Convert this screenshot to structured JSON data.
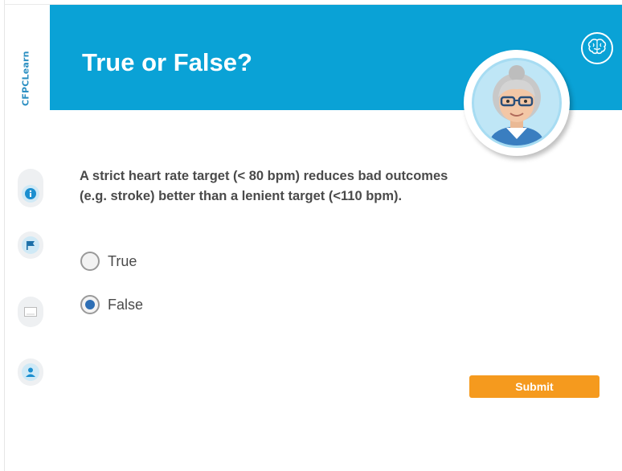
{
  "brand": {
    "name": "CFPCLearn"
  },
  "header": {
    "title": "True or False?"
  },
  "question": {
    "text": "A strict heart rate target (< 80 bpm) reduces bad outcomes (e.g. stroke) better than a lenient target (<110 bpm)."
  },
  "options": [
    {
      "label": "True",
      "selected": false
    },
    {
      "label": "False",
      "selected": true
    }
  ],
  "submit": {
    "label": "Submit"
  },
  "sidebar": {
    "items": [
      {
        "icon": "info-icon"
      },
      {
        "icon": "flag-icon"
      },
      {
        "icon": "note-icon"
      },
      {
        "icon": "person-icon"
      }
    ]
  },
  "colors": {
    "banner": "#0aa2d6",
    "accent_button": "#f59a1e",
    "radio_selected": "#2e6fb5",
    "text": "#4a4a4a"
  }
}
